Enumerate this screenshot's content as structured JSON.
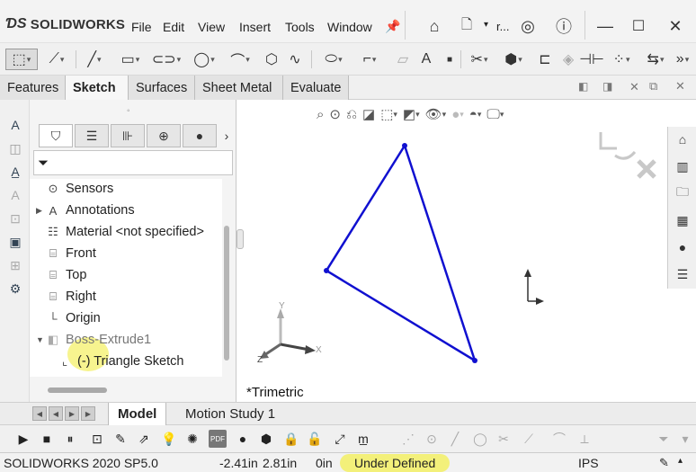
{
  "app": {
    "brand": "SOLIDWORKS",
    "menus": [
      "File",
      "Edit",
      "View",
      "Insert",
      "Tools",
      "Window"
    ],
    "search_hint": "r...",
    "icons": [
      "home-icon",
      "new-document-icon",
      "user-icon",
      "help-icon",
      "minimize-icon",
      "maximize-icon",
      "close-icon"
    ]
  },
  "command_tabs": [
    "Features",
    "Sketch",
    "Surfaces",
    "Sheet Metal",
    "Evaluate"
  ],
  "active_command_tab": "Sketch",
  "feature_tree": {
    "items": [
      {
        "label": "Sensors",
        "icon": "sensor-icon",
        "expandable": false
      },
      {
        "label": "Annotations",
        "icon": "annotation-icon",
        "expandable": true
      },
      {
        "label": "Material <not specified>",
        "icon": "material-icon",
        "expandable": false
      },
      {
        "label": "Front",
        "icon": "plane-icon",
        "expandable": false
      },
      {
        "label": "Top",
        "icon": "plane-icon",
        "expandable": false
      },
      {
        "label": "Right",
        "icon": "plane-icon",
        "expandable": false
      },
      {
        "label": "Origin",
        "icon": "origin-icon",
        "expandable": false
      },
      {
        "label": "Boss-Extrude1",
        "icon": "extrude-icon",
        "expandable": true
      },
      {
        "label": "(-) Triangle Sketch",
        "icon": "sketch-icon",
        "expandable": false
      }
    ]
  },
  "graphics": {
    "view_label": "*Trimetric",
    "triad_labels": {
      "x": "X",
      "y": "Y",
      "z": "Z"
    },
    "sketch_color": "#1010d0"
  },
  "bottom_tabs": [
    "Model",
    "Motion Study 1"
  ],
  "active_bottom_tab": "Model",
  "status": {
    "version": "SOLIDWORKS 2020 SP5.0",
    "x": "-2.41in",
    "y": "2.81in",
    "z": "0in",
    "state": "Under Defined",
    "units": "IPS"
  }
}
